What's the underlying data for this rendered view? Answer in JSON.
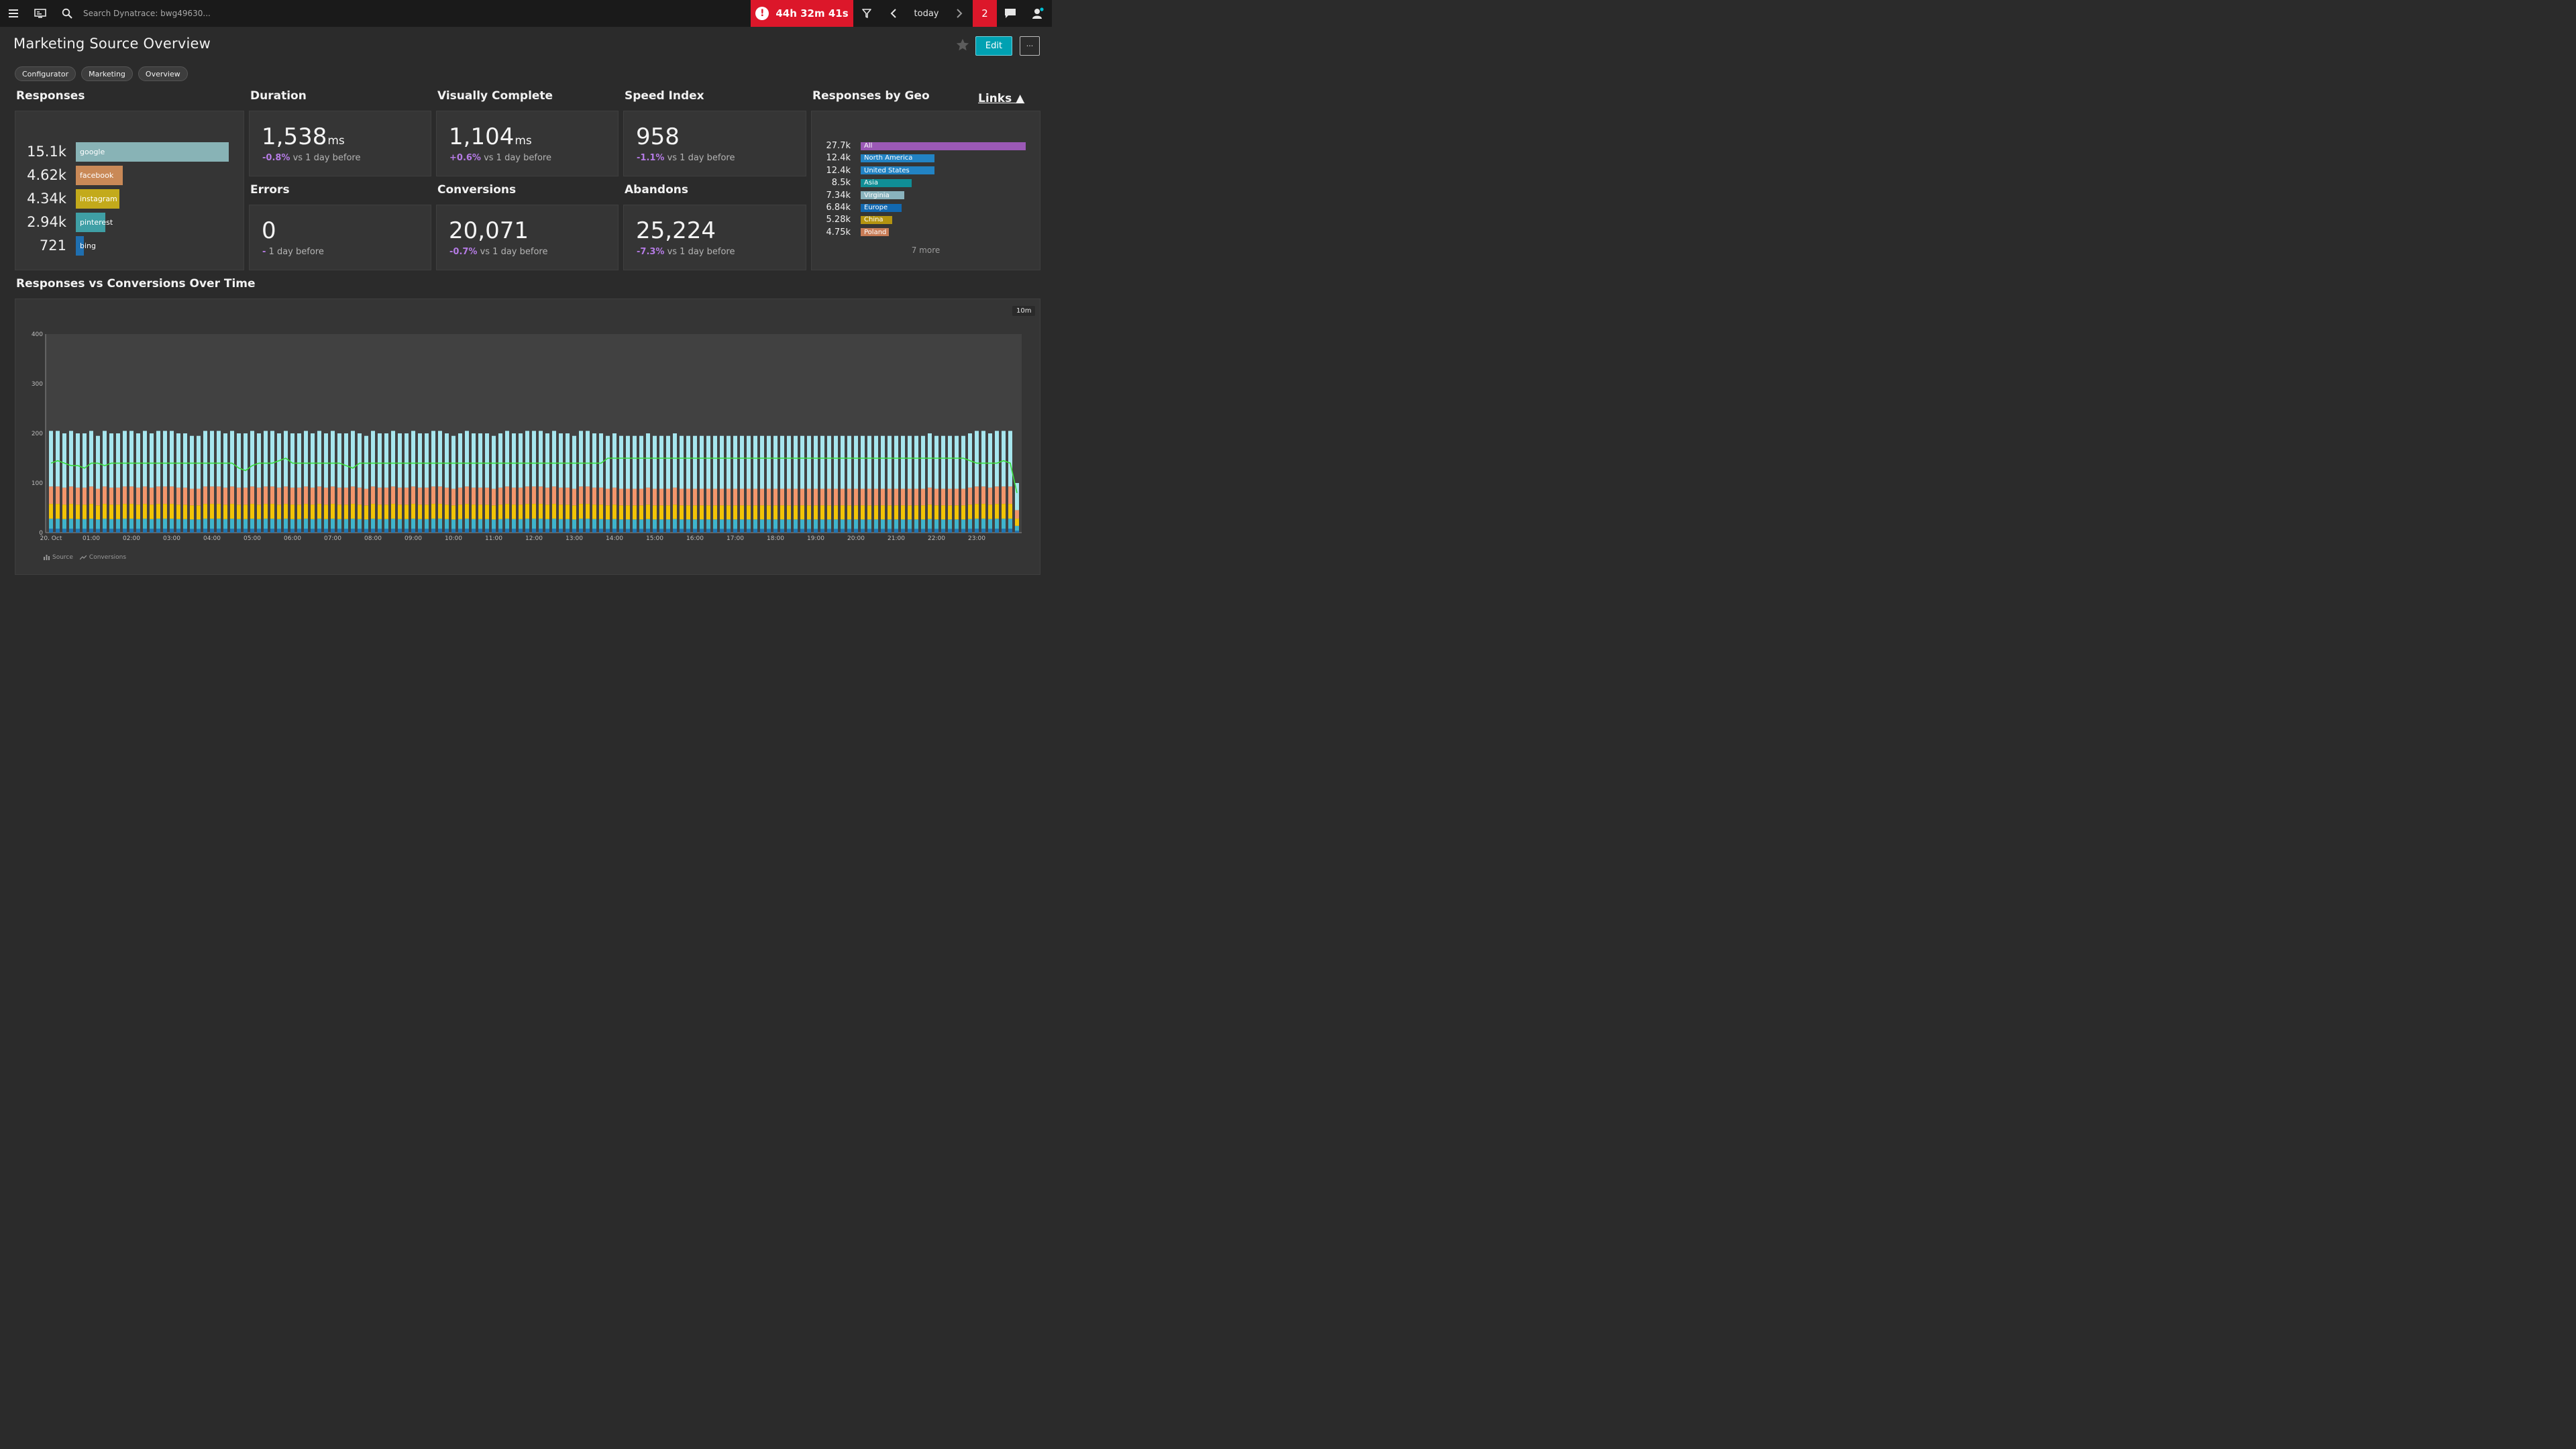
{
  "topbar": {
    "search_placeholder": "Search Dynatrace: bwg49630...",
    "problem_timer": "44h 32m 41s",
    "timeframe": "today",
    "problem_count": "2"
  },
  "header": {
    "title": "Marketing Source Overview",
    "edit_label": "Edit",
    "more_label": "···"
  },
  "tags": [
    "Configurator",
    "Marketing",
    "Overview"
  ],
  "responses": {
    "title": "Responses",
    "items": [
      {
        "value": "15.1k",
        "label": "google",
        "color": "#88b3b6",
        "fraction": 1.0
      },
      {
        "value": "4.62k",
        "label": "facebook",
        "color": "#c98957",
        "fraction": 0.306
      },
      {
        "value": "4.34k",
        "label": "instagram",
        "color": "#c3aa1b",
        "fraction": 0.287
      },
      {
        "value": "2.94k",
        "label": "pinterest",
        "color": "#3f9fa5",
        "fraction": 0.195
      },
      {
        "value": "721",
        "label": "bing",
        "color": "#1f6fb0",
        "fraction": 0.048
      }
    ]
  },
  "kpis": [
    {
      "id": "duration",
      "title": "Duration",
      "value": "1,538",
      "unit": "ms",
      "pct": "-0.8%",
      "suffix": " vs 1 day before"
    },
    {
      "id": "visually",
      "title": "Visually Complete",
      "value": "1,104",
      "unit": "ms",
      "pct": "+0.6%",
      "suffix": " vs 1 day before"
    },
    {
      "id": "speed",
      "title": "Speed Index",
      "value": "958",
      "unit": "",
      "pct": "-1.1%",
      "suffix": " vs 1 day before"
    },
    {
      "id": "errors",
      "title": "Errors",
      "value": "0",
      "unit": "",
      "pct": "-",
      "suffix": " 1 day before"
    },
    {
      "id": "conversions",
      "title": "Conversions",
      "value": "20,071",
      "unit": "",
      "pct": "-0.7%",
      "suffix": " vs 1 day before"
    },
    {
      "id": "abandons",
      "title": "Abandons",
      "value": "25,224",
      "unit": "",
      "pct": "-7.3%",
      "suffix": " vs 1 day before"
    }
  ],
  "geo": {
    "title": "Responses by Geo",
    "more": "7 more",
    "items": [
      {
        "value": "27.7k",
        "label": "All",
        "color": "#9b59b6",
        "fraction": 1.0
      },
      {
        "value": "12.4k",
        "label": "North America",
        "color": "#2283c4",
        "fraction": 0.448
      },
      {
        "value": "12.4k",
        "label": "United States",
        "color": "#2283c4",
        "fraction": 0.448
      },
      {
        "value": "8.5k",
        "label": "Asia",
        "color": "#108e96",
        "fraction": 0.307
      },
      {
        "value": "7.34k",
        "label": "Virginia",
        "color": "#8ab3bd",
        "fraction": 0.265
      },
      {
        "value": "6.84k",
        "label": "Europe",
        "color": "#1268b0",
        "fraction": 0.247
      },
      {
        "value": "5.28k",
        "label": "China",
        "color": "#b49410",
        "fraction": 0.191
      },
      {
        "value": "4.75k",
        "label": "Poland",
        "color": "#c87c56",
        "fraction": 0.171
      }
    ]
  },
  "links_label": "Links ▲",
  "chart_data": {
    "type": "bar",
    "title": "Responses vs Conversions Over Time",
    "resolution": "10m",
    "y_ticks": [
      "0",
      "100",
      "200",
      "300",
      "400"
    ],
    "ylim": [
      0,
      400
    ],
    "x_ticks": [
      "20. Oct",
      "01:00",
      "02:00",
      "03:00",
      "04:00",
      "05:00",
      "06:00",
      "07:00",
      "08:00",
      "09:00",
      "10:00",
      "11:00",
      "12:00",
      "13:00",
      "14:00",
      "15:00",
      "16:00",
      "17:00",
      "18:00",
      "19:00",
      "20:00",
      "21:00",
      "22:00",
      "23:00"
    ],
    "bars_per_hour": 6,
    "series": [
      {
        "name": "bing",
        "color": "#1f77b4",
        "approx_value": 8
      },
      {
        "name": "pinterest",
        "color": "#3fb4cc",
        "approx_value": 20
      },
      {
        "name": "instagram",
        "color": "#f2c407",
        "approx_value": 30
      },
      {
        "name": "facebook",
        "color": "#f2956b",
        "approx_value": 35
      },
      {
        "name": "google",
        "color": "#a6e6ee",
        "approx_value": 112
      }
    ],
    "total_bars_pattern": [
      205,
      205,
      200,
      205,
      200,
      200,
      205,
      195,
      205,
      200,
      200,
      205,
      205,
      200,
      205,
      200,
      205,
      205,
      205,
      200,
      200,
      195,
      195,
      205,
      205,
      205,
      200,
      205,
      200,
      200,
      205,
      200,
      205,
      205,
      200,
      205,
      200,
      200,
      205,
      200,
      205,
      200,
      205,
      200,
      200,
      205,
      200,
      195,
      205,
      200,
      200,
      205,
      200,
      200,
      205,
      200,
      200,
      205,
      205,
      200,
      195,
      200,
      205,
      200,
      200,
      200,
      195,
      200,
      205,
      200,
      200,
      205,
      205,
      205,
      200,
      205,
      200,
      200,
      195,
      205,
      205,
      200,
      200,
      195,
      200,
      195,
      195,
      195,
      195,
      200,
      195,
      195,
      195,
      200,
      195,
      195,
      195,
      195,
      195,
      195,
      195,
      195,
      195,
      195,
      195,
      195,
      195,
      195,
      195,
      195,
      195,
      195,
      195,
      195,
      195,
      195,
      195,
      195,
      195,
      195,
      195,
      195,
      195,
      195,
      195,
      195,
      195,
      195,
      195,
      195,
      195,
      200,
      195,
      195,
      195,
      195,
      195,
      200,
      205,
      205,
      200,
      205,
      205,
      205,
      100
    ],
    "conversions_line": [
      140,
      145,
      140,
      135,
      135,
      130,
      140,
      140,
      135,
      140,
      140,
      140,
      140,
      140,
      140,
      140,
      140,
      140,
      140,
      140,
      140,
      140,
      140,
      140,
      140,
      140,
      140,
      140,
      130,
      125,
      135,
      140,
      140,
      140,
      145,
      150,
      140,
      140,
      140,
      140,
      140,
      140,
      140,
      140,
      135,
      130,
      140,
      140,
      140,
      140,
      140,
      140,
      140,
      140,
      140,
      140,
      140,
      140,
      140,
      140,
      140,
      140,
      140,
      140,
      140,
      140,
      140,
      140,
      140,
      140,
      140,
      140,
      140,
      140,
      140,
      140,
      140,
      140,
      140,
      140,
      140,
      140,
      140,
      150,
      150,
      150,
      150,
      150,
      150,
      150,
      150,
      150,
      150,
      150,
      150,
      150,
      150,
      150,
      150,
      150,
      150,
      150,
      150,
      150,
      150,
      150,
      150,
      150,
      150,
      150,
      150,
      150,
      150,
      150,
      150,
      150,
      150,
      150,
      150,
      150,
      150,
      150,
      150,
      150,
      150,
      150,
      150,
      150,
      150,
      150,
      150,
      150,
      150,
      150,
      150,
      150,
      150,
      145,
      140,
      140,
      140,
      140,
      145,
      140,
      80
    ],
    "legend": [
      {
        "label": "Source"
      },
      {
        "label": "Conversions"
      }
    ]
  }
}
